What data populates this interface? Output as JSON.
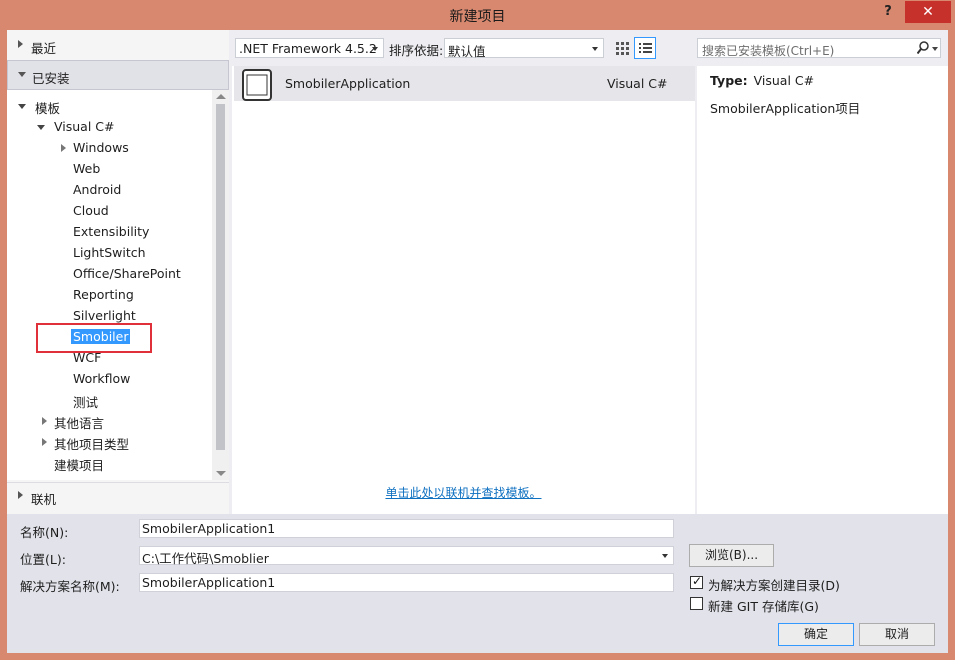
{
  "window": {
    "title": "新建项目",
    "help_label": "?",
    "close_label": "✕"
  },
  "left_panel": {
    "recent": "最近",
    "installed": "已安装",
    "online": "联机",
    "tree": {
      "templates": "模板",
      "visual_csharp": "Visual C#",
      "children": [
        "Windows",
        "Web",
        "Android",
        "Cloud",
        "Extensibility",
        "LightSwitch",
        "Office/SharePoint",
        "Reporting",
        "Silverlight",
        "Smobiler",
        "WCF",
        "Workflow",
        "测试"
      ],
      "other_languages": "其他语言",
      "other_project_types": "其他项目类型",
      "modeling_projects": "建模项目"
    },
    "selected_item": "Smobiler"
  },
  "toolbar": {
    "framework": ".NET Framework 4.5.2",
    "sort_label": "排序依据:",
    "sort_value": "默认值"
  },
  "template_list": {
    "items": [
      {
        "name": "SmobilerApplication",
        "language": "Visual C#",
        "icon": "mobile-device-icon"
      }
    ],
    "online_link": "单击此处以联机并查找模板。"
  },
  "details": {
    "search_placeholder": "搜索已安装模板(Ctrl+E)",
    "type_label": "Type:",
    "type_value": "Visual C#",
    "description": "SmobilerApplication项目"
  },
  "form": {
    "name_label": "名称(N):",
    "name_value": "SmobilerApplication1",
    "location_label": "位置(L):",
    "location_value": "C:\\工作代码\\Smoblier",
    "solution_label": "解决方案名称(M):",
    "solution_value": "SmobilerApplication1",
    "browse_button": "浏览(B)...",
    "create_dir_label": "为解决方案创建目录(D)",
    "create_dir_checked": true,
    "git_label": "新建 GIT 存储库(G)",
    "git_checked": false,
    "ok_button": "确定",
    "cancel_button": "取消"
  },
  "colors": {
    "title_bar": "#d7886f",
    "close_button": "#c7312b",
    "selection": "#3399ff",
    "highlight_box": "#e0303a",
    "link": "#0e70c0"
  }
}
